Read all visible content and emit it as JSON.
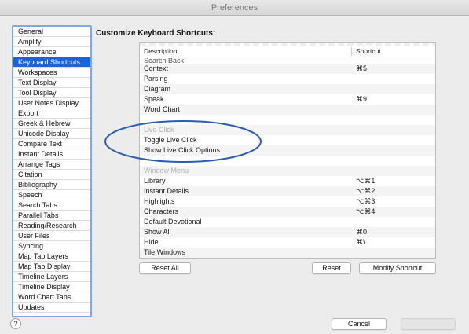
{
  "window": {
    "title": "Preferences"
  },
  "sidebar": {
    "items": [
      "General",
      "Amplify",
      "Appearance",
      "Keyboard Shortcuts",
      "Workspaces",
      "Text Display",
      "Tool Display",
      "User Notes Display",
      "Export",
      "Greek & Hebrew",
      "Unicode Display",
      "Compare Text",
      "Instant Details",
      "Arrange Tags",
      "Citation",
      "Bibliography",
      "Speech",
      "Search Tabs",
      "Parallel Tabs",
      "Reading/Research",
      "User Files",
      "Syncing",
      "Map Tab Layers",
      "Map Tab Display",
      "Timeline Layers",
      "Timeline Display",
      "Word Chart Tabs",
      "Updates"
    ],
    "selected": "Keyboard Shortcuts"
  },
  "main": {
    "heading": "Customize Keyboard Shortcuts:",
    "columns": {
      "description": "Description",
      "shortcut": "Shortcut"
    },
    "partial_row": "Search Back",
    "rows": [
      {
        "description": "Context",
        "shortcut": "⌘5",
        "section": false
      },
      {
        "description": "Parsing",
        "shortcut": "",
        "section": false
      },
      {
        "description": "Diagram",
        "shortcut": "",
        "section": false
      },
      {
        "description": "Speak",
        "shortcut": "⌘9",
        "section": false
      },
      {
        "description": "Word Chart",
        "shortcut": "",
        "section": false
      },
      {
        "description": "",
        "shortcut": "",
        "section": false
      },
      {
        "description": "Live Click",
        "shortcut": "",
        "section": true
      },
      {
        "description": "Toggle Live Click",
        "shortcut": "",
        "section": false
      },
      {
        "description": "Show Live Click Options",
        "shortcut": "",
        "section": false
      },
      {
        "description": "",
        "shortcut": "",
        "section": false
      },
      {
        "description": "Window Menu",
        "shortcut": "",
        "section": true
      },
      {
        "description": "Library",
        "shortcut": "⌥⌘1",
        "section": false
      },
      {
        "description": "Instant Details",
        "shortcut": "⌥⌘2",
        "section": false
      },
      {
        "description": "Highlights",
        "shortcut": "⌥⌘3",
        "section": false
      },
      {
        "description": "Characters",
        "shortcut": "⌥⌘4",
        "section": false
      },
      {
        "description": "Default Devotional",
        "shortcut": "",
        "section": false
      },
      {
        "description": "Show All",
        "shortcut": "⌘0",
        "section": false
      },
      {
        "description": "Hide",
        "shortcut": "⌘\\",
        "section": false
      },
      {
        "description": "Tile Windows",
        "shortcut": "",
        "section": false
      }
    ],
    "buttons": {
      "reset_all": "Reset All",
      "reset": "Reset",
      "modify": "Modify Shortcut"
    }
  },
  "footer": {
    "help": "?",
    "cancel": "Cancel",
    "ok": ""
  },
  "colors": {
    "selection": "#1a64d8",
    "annotation": "#2a5db0",
    "focus_ring": "#7fa9e6"
  }
}
